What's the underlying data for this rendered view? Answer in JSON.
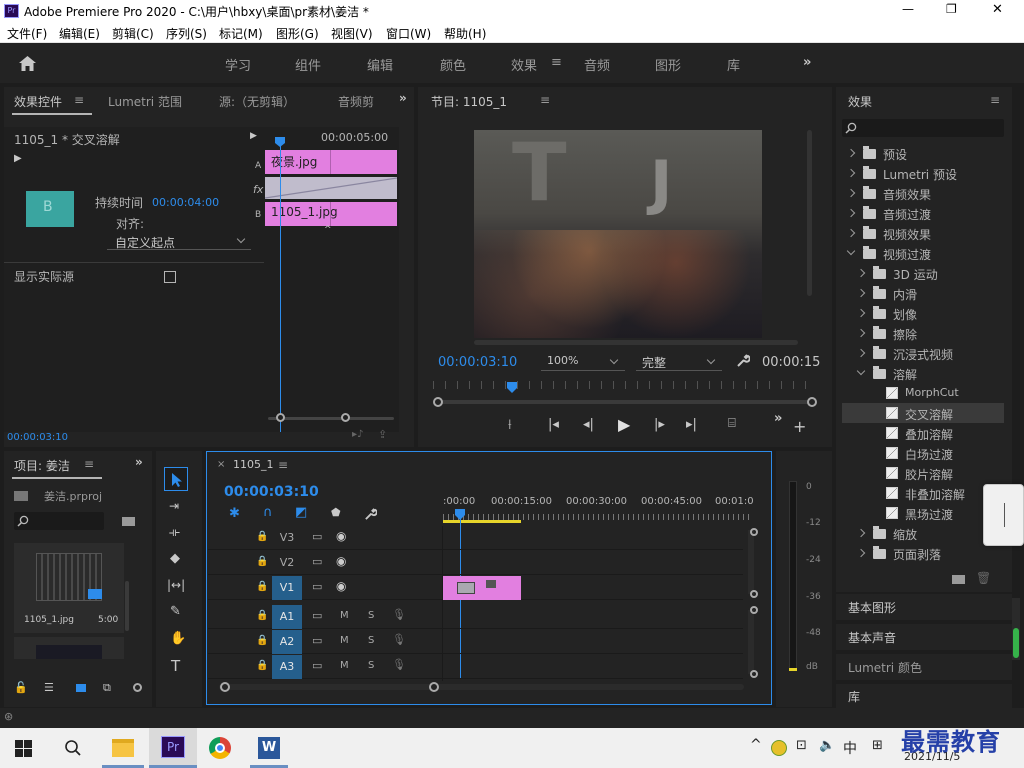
{
  "app_title": "Adobe Premiere Pro 2020 - C:\\用户\\hbxy\\桌面\\pr素材\\姜洁 *",
  "window_controls": {
    "minimize": "—",
    "restore": "❐",
    "close": "✕"
  },
  "menu": [
    "文件(F)",
    "编辑(E)",
    "剪辑(C)",
    "序列(S)",
    "标记(M)",
    "图形(G)",
    "视图(V)",
    "窗口(W)",
    "帮助(H)"
  ],
  "workspaces": [
    "学习",
    "组件",
    "编辑",
    "颜色",
    "效果",
    "音频",
    "图形",
    "库"
  ],
  "active_workspace": "效果",
  "effect_controls": {
    "tabs": [
      "效果控件",
      "Lumetri 范围",
      "源:（无剪辑）",
      "音频剪"
    ],
    "clip_header": "1105_1 * 交叉溶解",
    "timecode_header": "00:00:05:00",
    "duration_label": "持续时间",
    "duration_value": "00:00:04:00",
    "align_label": "对齐:",
    "align_value": "自定义起点",
    "show_source_label": "显示实际源",
    "track_a_label": "A",
    "track_b_label": "B",
    "fx_label": "fx",
    "clip_a_name": "夜景.jpg",
    "clip_b_name": "1105_1.jpg",
    "current_time": "00:00:03:10"
  },
  "program_monitor": {
    "title": "节目: 1105_1",
    "timecode": "00:00:03:10",
    "zoom": "100%",
    "quality": "完整",
    "duration": "00:00:15"
  },
  "effects_panel": {
    "title": "效果",
    "search_placeholder": "",
    "items": [
      {
        "label": "预设",
        "level": 0,
        "type": "bin"
      },
      {
        "label": "Lumetri 预设",
        "level": 0,
        "type": "bin"
      },
      {
        "label": "音频效果",
        "level": 0,
        "type": "folder"
      },
      {
        "label": "音频过渡",
        "level": 0,
        "type": "folder"
      },
      {
        "label": "视频效果",
        "level": 0,
        "type": "folder"
      },
      {
        "label": "视频过渡",
        "level": 0,
        "type": "folder",
        "expanded": true
      },
      {
        "label": "3D 运动",
        "level": 1,
        "type": "folder"
      },
      {
        "label": "内滑",
        "level": 1,
        "type": "folder"
      },
      {
        "label": "划像",
        "level": 1,
        "type": "folder"
      },
      {
        "label": "擦除",
        "level": 1,
        "type": "folder"
      },
      {
        "label": "沉浸式视频",
        "level": 1,
        "type": "folder"
      },
      {
        "label": "溶解",
        "level": 1,
        "type": "folder",
        "expanded": true
      },
      {
        "label": "MorphCut",
        "level": 2,
        "type": "effect"
      },
      {
        "label": "交叉溶解",
        "level": 2,
        "type": "effect",
        "selected": true
      },
      {
        "label": "叠加溶解",
        "level": 2,
        "type": "effect"
      },
      {
        "label": "白场过渡",
        "level": 2,
        "type": "effect"
      },
      {
        "label": "胶片溶解",
        "level": 2,
        "type": "effect"
      },
      {
        "label": "非叠加溶解",
        "level": 2,
        "type": "effect"
      },
      {
        "label": "黑场过渡",
        "level": 2,
        "type": "effect"
      },
      {
        "label": "缩放",
        "level": 1,
        "type": "folder"
      },
      {
        "label": "页面剥落",
        "level": 1,
        "type": "folder"
      }
    ]
  },
  "side_panels": [
    "基本图形",
    "基本声音",
    "Lumetri 颜色",
    "库"
  ],
  "project_panel": {
    "title": "项目: 姜洁",
    "project_file": "姜洁.prproj",
    "clip_name": "1105_1.jpg",
    "clip_duration": "5:00"
  },
  "timeline": {
    "sequence_name": "1105_1",
    "timecode": "00:00:03:10",
    "ruler": [
      ":00:00",
      "00:00:15:00",
      "00:00:30:00",
      "00:00:45:00",
      "00:01:0"
    ],
    "tracks": [
      {
        "name": "V3",
        "kind": "video"
      },
      {
        "name": "V2",
        "kind": "video"
      },
      {
        "name": "V1",
        "kind": "video",
        "targeted": true
      },
      {
        "name": "A1",
        "kind": "audio",
        "targeted": true
      },
      {
        "name": "A2",
        "kind": "audio",
        "targeted": true
      },
      {
        "name": "A3",
        "kind": "audio",
        "targeted": true
      }
    ],
    "m_label": "M",
    "s_label": "S"
  },
  "audio_meter": {
    "ticks": [
      "0",
      "-12",
      "-24",
      "-36",
      "-48",
      "dB"
    ]
  },
  "taskbar": {
    "apps": [
      "file-explorer",
      "premiere",
      "chrome",
      "word"
    ],
    "ime": "中",
    "clock_time": "",
    "clock_date": "2021/11/5",
    "watermark": "最需教育"
  },
  "colors": {
    "accent": "#2d8ceb",
    "clip": "#e27fe0",
    "bg": "#232323",
    "target": "#255f8c"
  }
}
